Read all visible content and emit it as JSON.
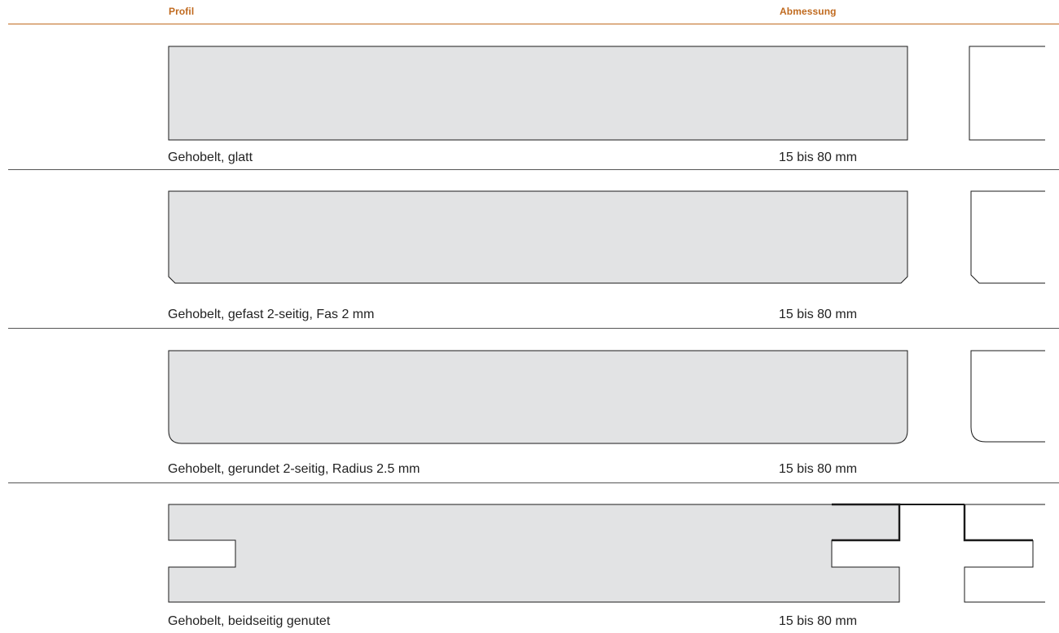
{
  "header": {
    "profil_label": "Profil",
    "abmessung_label": "Abmessung"
  },
  "colors": {
    "accent": "#c06a1f",
    "profile_fill": "#e2e3e4",
    "profile_stroke": "#1a1a1a"
  },
  "profiles": [
    {
      "name": "Gehobelt, glatt",
      "dimension": "15 bis 80 mm",
      "edge": "square"
    },
    {
      "name": "Gehobelt, gefast 2-seitig, Fas 2 mm",
      "dimension": "15 bis 80 mm",
      "edge": "chamfer"
    },
    {
      "name": "Gehobelt, gerundet 2-seitig, Radius 2.5 mm",
      "dimension": "15 bis 80 mm",
      "edge": "rounded"
    },
    {
      "name": "Gehobelt, beidseitig genutet",
      "dimension": "15 bis 80 mm",
      "edge": "grooved"
    }
  ]
}
